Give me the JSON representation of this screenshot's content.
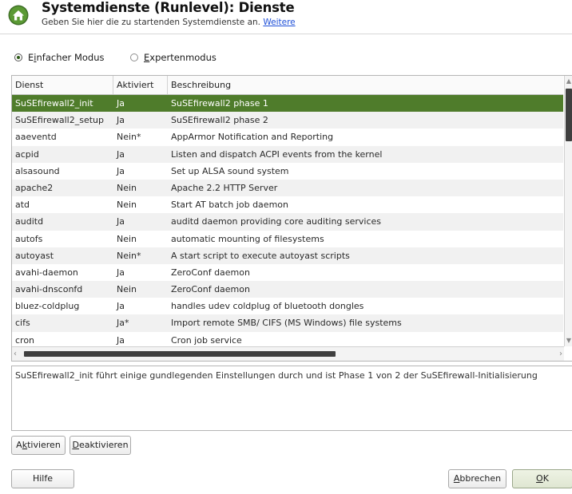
{
  "header": {
    "title": "Systemdienste (Runlevel): Dienste",
    "subtitle": "Geben Sie hier die zu startenden Systemdienste an.",
    "link": "Weitere"
  },
  "modes": {
    "simple": {
      "pre": "E",
      "key": "i",
      "post": "nfacher Modus",
      "checked": true
    },
    "expert": {
      "pre": "",
      "key": "E",
      "post": "xpertenmodus",
      "checked": false
    }
  },
  "table": {
    "columns": [
      "Dienst",
      "Aktiviert",
      "Beschreibung"
    ],
    "selected_index": 0,
    "rows": [
      {
        "service": "SuSEfirewall2_init",
        "enabled": "Ja",
        "description": "SuSEfirewall2 phase 1"
      },
      {
        "service": "SuSEfirewall2_setup",
        "enabled": "Ja",
        "description": "SuSEfirewall2 phase 2"
      },
      {
        "service": "aaeventd",
        "enabled": "Nein*",
        "description": "AppArmor Notification and Reporting"
      },
      {
        "service": "acpid",
        "enabled": "Ja",
        "description": "Listen and dispatch ACPI events from the kernel"
      },
      {
        "service": "alsasound",
        "enabled": "Ja",
        "description": "Set up ALSA sound system"
      },
      {
        "service": "apache2",
        "enabled": "Nein",
        "description": "Apache 2.2 HTTP Server"
      },
      {
        "service": "atd",
        "enabled": "Nein",
        "description": "Start AT batch job daemon"
      },
      {
        "service": "auditd",
        "enabled": "Ja",
        "description": "auditd daemon providing core auditing services"
      },
      {
        "service": "autofs",
        "enabled": "Nein",
        "description": "automatic mounting of filesystems"
      },
      {
        "service": "autoyast",
        "enabled": "Nein*",
        "description": "A start script to execute autoyast scripts"
      },
      {
        "service": "avahi-daemon",
        "enabled": "Ja",
        "description": "ZeroConf daemon"
      },
      {
        "service": "avahi-dnsconfd",
        "enabled": "Nein",
        "description": "ZeroConf daemon"
      },
      {
        "service": "bluez-coldplug",
        "enabled": "Ja",
        "description": "handles udev coldplug of bluetooth dongles"
      },
      {
        "service": "cifs",
        "enabled": "Ja*",
        "description": "Import remote SMB/ CIFS (MS Windows) file systems"
      },
      {
        "service": "cron",
        "enabled": "Ja",
        "description": "Cron job service"
      }
    ]
  },
  "description_text": "SuSEfirewall2_init führt einige gundlegenden Einstellungen durch und ist Phase 1 von 2 der SuSEfirewall-Initialisierung",
  "buttons": {
    "activate": {
      "pre": "A",
      "key": "k",
      "post": "tivieren"
    },
    "deactivate": {
      "pre": "",
      "key": "D",
      "post": "eaktivieren"
    },
    "help": "Hilfe",
    "cancel": {
      "pre": "",
      "key": "A",
      "post": "bbrechen"
    },
    "ok": {
      "pre": "",
      "key": "O",
      "post": "K"
    }
  },
  "colors": {
    "selection": "#4f7c2b",
    "link": "#1e4fd8"
  },
  "icons": {
    "app": "house-icon",
    "scroll_up": "chevron-up-icon",
    "scroll_down": "chevron-down-icon",
    "scroll_left": "chevron-left-icon",
    "scroll_right": "chevron-right-icon"
  }
}
